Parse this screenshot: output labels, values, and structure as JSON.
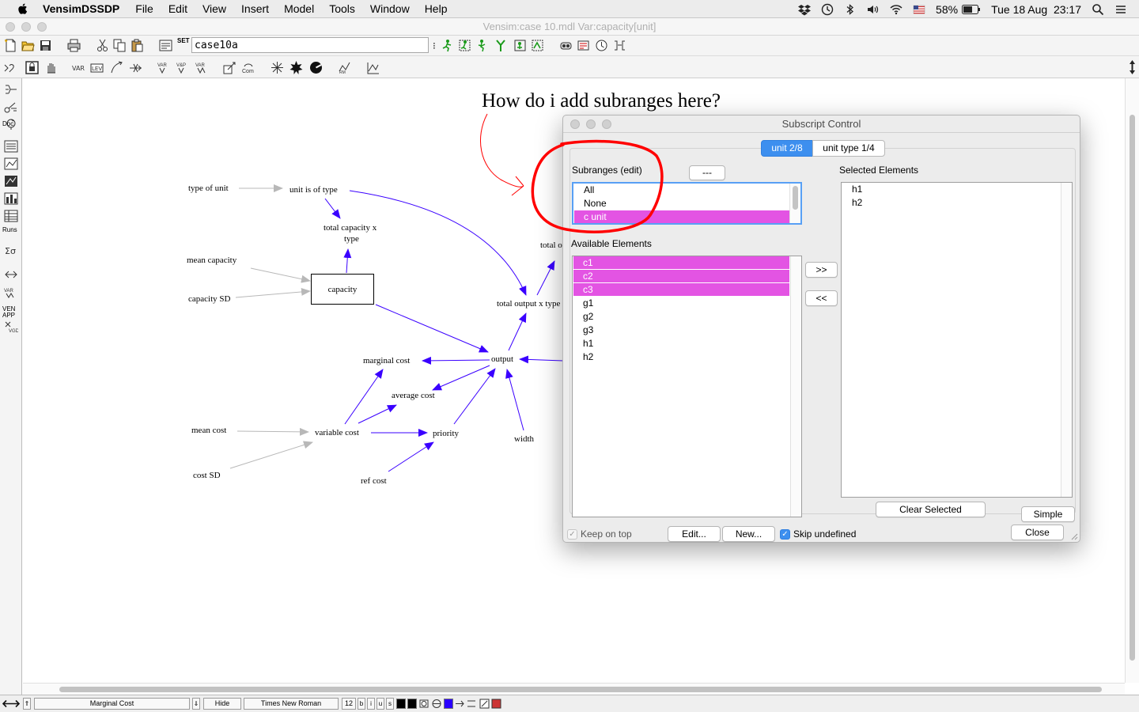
{
  "menubar": {
    "app_name": "VensimDSSDP",
    "items": [
      "File",
      "Edit",
      "View",
      "Insert",
      "Model",
      "Tools",
      "Window",
      "Help"
    ],
    "battery": "58%",
    "datetime": "Tue 18 Aug  23:17"
  },
  "window": {
    "title": "Vensim:case 10.mdl Var:capacity[unit]"
  },
  "toolbar": {
    "view_name": "case10a",
    "set_label": "SET"
  },
  "left_tools": {
    "doc_label": "Doc",
    "runs_label": "Runs",
    "ven_app_label": "VEN APP"
  },
  "canvas": {
    "question": "How do i add subranges here?",
    "variables": {
      "type_of_unit": "type of unit",
      "unit_is_of_type": "unit is of type",
      "total_capacity_x_type_1": "total capacity x",
      "total_capacity_x_type_2": "type",
      "mean_capacity": "mean capacity",
      "capacity_sd": "capacity SD",
      "capacity": "capacity",
      "total_o": "total o",
      "total_output_x_type": "total output x type",
      "marginal_cost": "marginal cost",
      "output": "output",
      "average_cost": "average cost",
      "mean_cost": "mean cost",
      "variable_cost": "variable cost",
      "priority": "priority",
      "width": "width",
      "cost_sd": "cost SD",
      "ref_cost": "ref cost"
    }
  },
  "statusbar": {
    "variable": "Marginal Cost",
    "hide": "Hide",
    "font": "Times New Roman",
    "font_size": "12",
    "bold": "b",
    "italic": "i",
    "underline": "u",
    "strike": "s"
  },
  "dialog": {
    "title": "Subscript Control",
    "tabs": [
      {
        "label": "unit  2/8",
        "active": true
      },
      {
        "label": "unit type  1/4",
        "active": false
      }
    ],
    "subranges_label": "Subranges (edit)",
    "dash_button": "---",
    "subranges": [
      {
        "label": "All",
        "selected": false
      },
      {
        "label": "None",
        "selected": false
      },
      {
        "label": "c unit",
        "selected": true
      }
    ],
    "available_label": "Available Elements",
    "available": [
      {
        "label": "c1",
        "selected": true
      },
      {
        "label": "c2",
        "selected": true
      },
      {
        "label": "c3",
        "selected": true
      },
      {
        "label": "g1",
        "selected": false
      },
      {
        "label": "g2",
        "selected": false
      },
      {
        "label": "g3",
        "selected": false
      },
      {
        "label": "h1",
        "selected": false
      },
      {
        "label": "h2",
        "selected": false
      }
    ],
    "selected_label": "Selected Elements",
    "selected": [
      "h1",
      "h2"
    ],
    "add_button": ">>",
    "remove_button": "<<",
    "clear_selected_button": "Clear Selected",
    "simple_button": "Simple",
    "close_button": "Close",
    "keep_on_top_label": "Keep on top",
    "keep_on_top_checked": true,
    "edit_button": "Edit...",
    "new_button": "New...",
    "skip_undefined_label": "Skip undefined",
    "skip_undefined_checked": true
  },
  "colors": {
    "arrow": "#3a00ff",
    "shadow_arrow": "#b8b8b8",
    "selection": "#e354e3",
    "accent_blue": "#3d8fef",
    "annotation_red": "#ff0000"
  }
}
